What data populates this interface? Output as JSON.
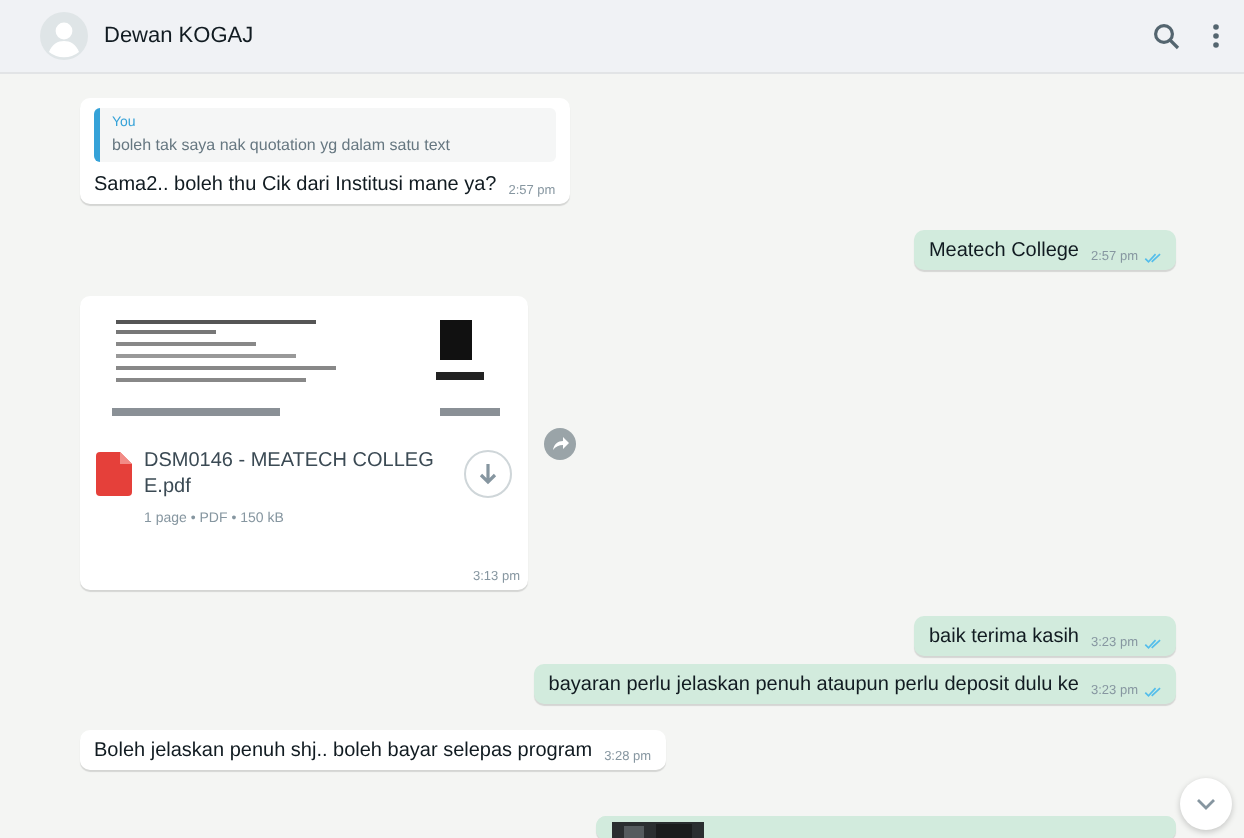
{
  "header": {
    "contact_name": "Dewan KOGAJ"
  },
  "messages": [
    {
      "kind": "text",
      "outgoing": false,
      "quote": {
        "author": "You",
        "text": "boleh tak saya nak quotation yg dalam satu text"
      },
      "text": "Sama2.. boleh thu Cik dari Institusi mane ya?",
      "time": "2:57 pm"
    },
    {
      "kind": "text",
      "outgoing": true,
      "text": "Meatech College",
      "time": "2:57 pm",
      "read": true
    },
    {
      "kind": "document",
      "outgoing": false,
      "file_name": "DSM0146 - MEATECH COLLEGE.pdf",
      "file_meta": "1 page • PDF • 150 kB",
      "time": "3:13 pm"
    },
    {
      "kind": "text",
      "outgoing": true,
      "text": "baik terima kasih",
      "time": "3:23 pm",
      "read": true
    },
    {
      "kind": "text",
      "outgoing": true,
      "text": "bayaran perlu jelaskan penuh ataupun perlu deposit dulu ke",
      "time": "3:23 pm",
      "read": true
    },
    {
      "kind": "text",
      "outgoing": false,
      "text": "Boleh jelaskan penuh shj.. boleh bayar selepas program",
      "time": "3:28 pm"
    },
    {
      "kind": "picture",
      "outgoing": true
    }
  ]
}
